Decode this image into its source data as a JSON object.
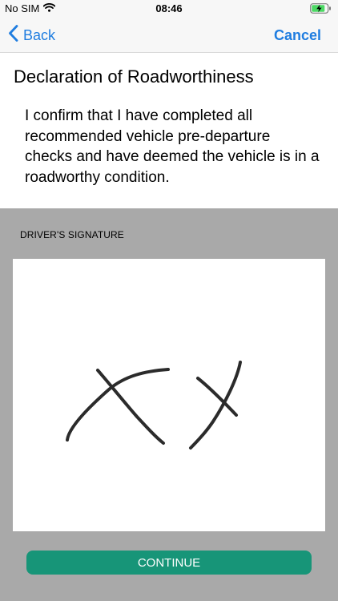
{
  "status_bar": {
    "carrier": "No SIM",
    "time": "08:46",
    "icons": [
      "wifi-icon",
      "battery-charging-icon"
    ]
  },
  "nav": {
    "back_label": "Back",
    "cancel_label": "Cancel"
  },
  "page": {
    "title": "Declaration of Roadworthiness",
    "declaration": "I confirm that I have completed all recommended vehicle pre-departure checks and have deemed the vehicle is in a roadworthy condition."
  },
  "signature": {
    "label": "DRIVER'S SIGNATURE"
  },
  "actions": {
    "continue_label": "CONTINUE"
  },
  "colors": {
    "accent": "#1f7de0",
    "continue_button": "#179578",
    "signature_background": "#a9a9a9",
    "battery_charging": "#4cd964"
  }
}
